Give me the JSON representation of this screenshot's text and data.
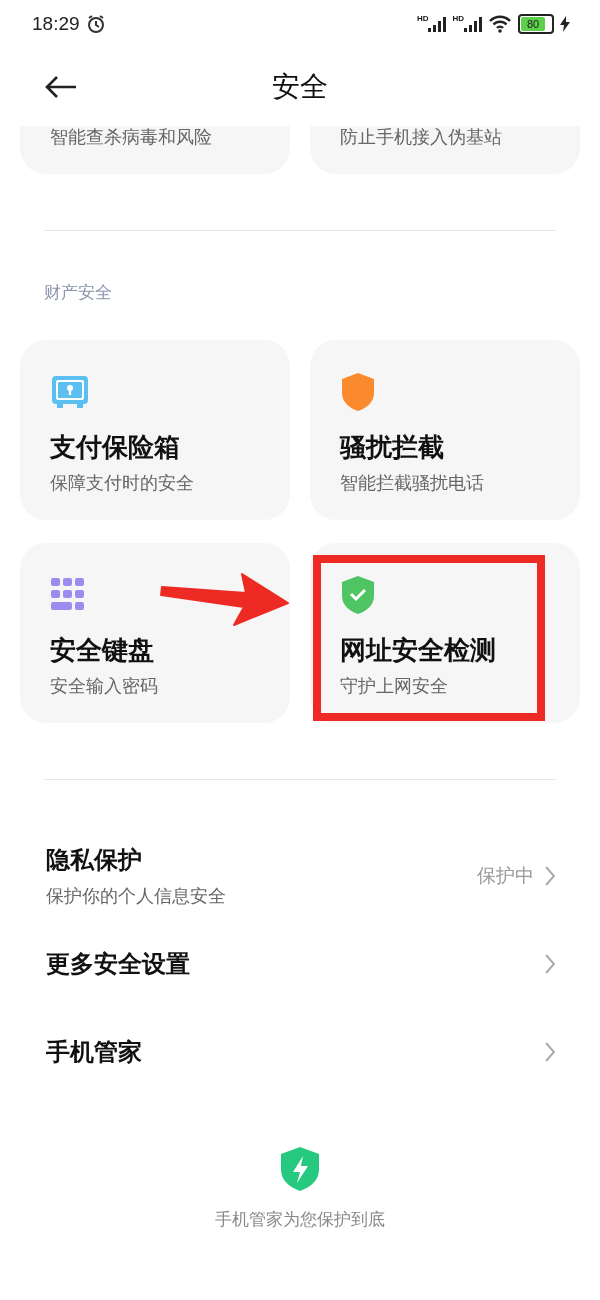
{
  "status_bar": {
    "time": "18:29",
    "signals": [
      {
        "label": "HD"
      },
      {
        "label": "HD"
      }
    ],
    "battery": {
      "label": "80"
    }
  },
  "header": {
    "title": "安全"
  },
  "top_cards": [
    {
      "subtitle": "智能查杀病毒和风险"
    },
    {
      "subtitle": "防止手机接入伪基站"
    }
  ],
  "section_title": "财产安全",
  "cards": [
    {
      "title": "支付保险箱",
      "subtitle": "保障支付时的安全",
      "highlighted": false
    },
    {
      "title": "骚扰拦截",
      "subtitle": "智能拦截骚扰电话",
      "highlighted": false
    },
    {
      "title": "安全键盘",
      "subtitle": "安全输入密码",
      "highlighted": false
    },
    {
      "title": "网址安全检测",
      "subtitle": "守护上网安全",
      "highlighted": true
    }
  ],
  "list": [
    {
      "title": "隐私保护",
      "subtitle": "保护你的个人信息安全",
      "value": "保护中"
    },
    {
      "title": "更多安全设置"
    },
    {
      "title": "手机管家"
    }
  ],
  "footer": {
    "text": "手机管家为您保护到底"
  }
}
